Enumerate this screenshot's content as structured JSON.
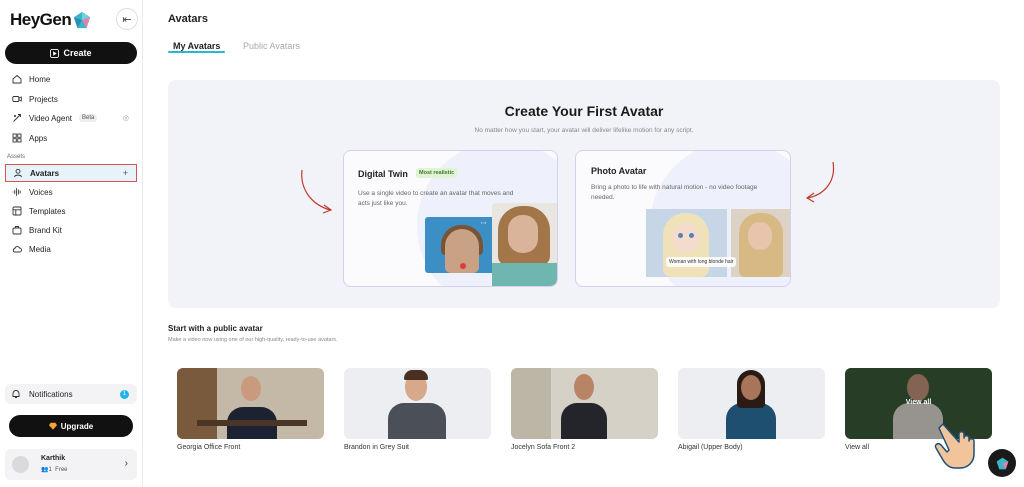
{
  "app": {
    "brand": "HeyGen"
  },
  "sidebar": {
    "create_label": "Create",
    "nav": [
      {
        "label": "Home",
        "icon": "home-icon"
      },
      {
        "label": "Projects",
        "icon": "video-icon"
      },
      {
        "label": "Video Agent",
        "icon": "agent-icon",
        "badge": "Beta"
      },
      {
        "label": "Apps",
        "icon": "apps-icon"
      }
    ],
    "assets_label": "Assets",
    "assets": [
      {
        "label": "Avatars",
        "icon": "user-icon",
        "active": true
      },
      {
        "label": "Voices",
        "icon": "waveform-icon"
      },
      {
        "label": "Templates",
        "icon": "template-icon"
      },
      {
        "label": "Brand Kit",
        "icon": "brand-kit-icon"
      },
      {
        "label": "Media",
        "icon": "cloud-icon"
      }
    ],
    "notifications_label": "Notifications",
    "notifications_count": "1",
    "upgrade_label": "Upgrade",
    "user": {
      "name": "Karthik",
      "seats": "1",
      "plan": "Free"
    }
  },
  "main": {
    "title": "Avatars",
    "tabs": [
      {
        "label": "My Avatars",
        "active": true
      },
      {
        "label": "Public Avatars",
        "active": false
      }
    ],
    "hero": {
      "title": "Create Your First Avatar",
      "subtitle": "No matter how you start, your avatar will deliver lifelike motion for any script.",
      "digital_twin": {
        "title": "Digital Twin",
        "badge": "Most realistic",
        "description": "Use a single video to create an avatar that moves and acts just like you."
      },
      "photo_avatar": {
        "title": "Photo Avatar",
        "description": "Bring a photo to life with natural motion - no video footage needed.",
        "caption": "Woman with long blonde hair"
      }
    },
    "public_section": {
      "title": "Start with a public avatar",
      "subtitle": "Make a video now using one of our high-quality, ready-to-use avatars.",
      "avatars": [
        {
          "name": "Georgia Office Front"
        },
        {
          "name": "Brandon in Grey Suit"
        },
        {
          "name": "Jocelyn Sofa Front 2"
        },
        {
          "name": "Abigail (Upper Body)"
        },
        {
          "name": "View all"
        }
      ],
      "view_all_overlay": "View all"
    }
  },
  "colors": {
    "accent": "#2ab7d6",
    "primary": "#111111",
    "card_border": "#d6cff0",
    "hero_bg": "#f2f3f8"
  }
}
